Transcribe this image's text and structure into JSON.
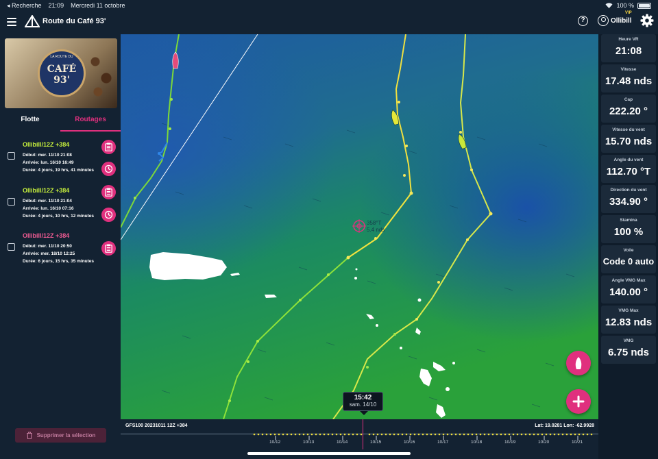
{
  "status_bar": {
    "back": "◂ Recherche",
    "time": "21:09",
    "date": "Mercredi 11 octobre",
    "battery": "100 %"
  },
  "header": {
    "title": "Route du Café 93'",
    "help": "?",
    "user": "Ollibill",
    "vip": "VIP"
  },
  "banner": {
    "top_text": "LA ROUTE DU",
    "main_text": "CAFÉ 93'"
  },
  "tabs": [
    "Flotte",
    "Routages"
  ],
  "routes": [
    {
      "name": "Ollibill/12Z +384",
      "color": "#c6ef3c",
      "start": "Début: mer. 11/10 21:08",
      "arrival": "Arrivée: lun. 16/10 16:49",
      "duration": "Durée: 4 jours, 19 hrs, 41 minutes"
    },
    {
      "name": "Ollibill/12Z +384",
      "color": "#c6ef3c",
      "start": "Début: mer. 11/10 21:04",
      "arrival": "Arrivée: lun. 16/10 07:16",
      "duration": "Durée: 4 jours, 10 hrs, 12 minutes"
    },
    {
      "name": "Ollibill/12Z +384",
      "color": "#f05b93",
      "start": "Début: mer. 11/10 20:50",
      "arrival": "Arrivée: mer. 18/10 12:25",
      "duration": "Durée: 6 jours, 15 hrs, 35 minutes"
    }
  ],
  "delete_button": "Supprimer la sélection",
  "map": {
    "cursor_label_1": "358°T",
    "cursor_label_2": "5.4 nds"
  },
  "stats": [
    {
      "label": "Heure VR",
      "value": "21:08"
    },
    {
      "label": "Vitesse",
      "value": "17.48 nds"
    },
    {
      "label": "Cap",
      "value": "222.20 °"
    },
    {
      "label": "Vitesse du vent",
      "value": "15.70 nds"
    },
    {
      "label": "Angle du vent",
      "value": "112.70 °T"
    },
    {
      "label": "Direction du vent",
      "value": "334.90 °"
    },
    {
      "label": "Stamina",
      "value": "100 %"
    },
    {
      "label": "Voile",
      "value": "Code 0 auto"
    },
    {
      "label": "Angle VMG Max",
      "value": "140.00 °"
    },
    {
      "label": "VMG Max",
      "value": "12.83 nds"
    },
    {
      "label": "VMG",
      "value": "6.75 nds"
    }
  ],
  "timeline": {
    "model": "GFS100 20231011 12Z +384",
    "latlon": "Lat: 19.0281 Lon: -62.9928",
    "tooltip_time": "15:42",
    "tooltip_date": "sam. 14/10",
    "dates": [
      "10/12",
      "10/13",
      "10/14",
      "10/15",
      "10/16",
      "10/17",
      "10/18",
      "10/19",
      "10/20",
      "10/21"
    ]
  }
}
